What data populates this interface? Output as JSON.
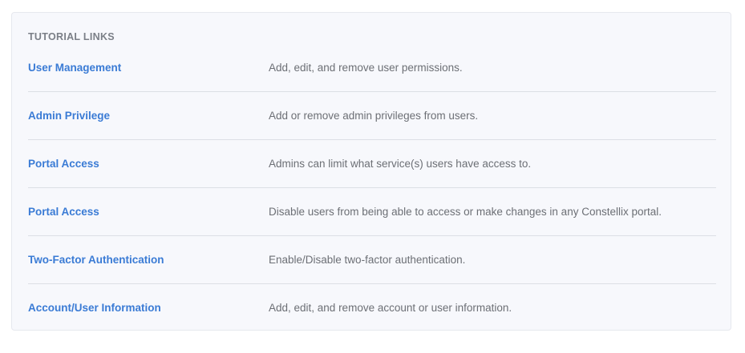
{
  "section": {
    "title": "TUTORIAL LINKS"
  },
  "links": [
    {
      "title": "User Management",
      "description": "Add, edit, and remove user permissions."
    },
    {
      "title": "Admin Privilege",
      "description": "Add or remove admin privileges from users."
    },
    {
      "title": "Portal Access",
      "description": "Admins can limit what service(s) users have access to."
    },
    {
      "title": "Portal Access",
      "description": "Disable users from being able to access or make changes in any Constellix portal."
    },
    {
      "title": "Two-Factor Authentication",
      "description": "Enable/Disable two-factor authentication."
    },
    {
      "title": "Account/User Information",
      "description": "Add, edit, and remove account or user information."
    }
  ],
  "colors": {
    "link": "#3a7bd5",
    "description": "#6c6f75",
    "heading": "#7b7f87",
    "panel_background": "#f7f8fc",
    "divider": "#dcdfe5"
  }
}
